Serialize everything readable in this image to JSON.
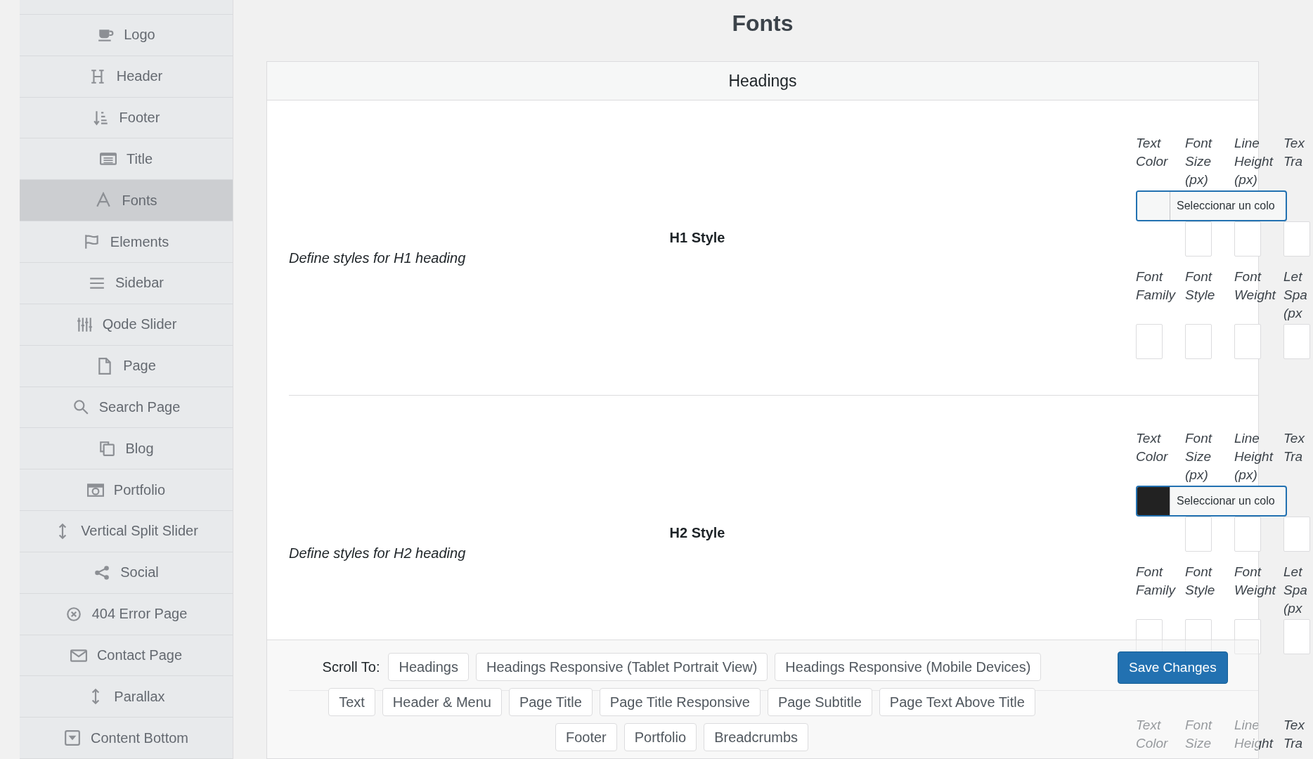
{
  "page_title": "Fonts",
  "sidebar": {
    "items": [
      {
        "label": "Logo",
        "selected": false
      },
      {
        "label": "Header",
        "selected": false
      },
      {
        "label": "Footer",
        "selected": false
      },
      {
        "label": "Title",
        "selected": false
      },
      {
        "label": "Fonts",
        "selected": true
      },
      {
        "label": "Elements",
        "selected": false
      },
      {
        "label": "Sidebar",
        "selected": false
      },
      {
        "label": "Qode Slider",
        "selected": false
      },
      {
        "label": "Page",
        "selected": false
      },
      {
        "label": "Search Page",
        "selected": false
      },
      {
        "label": "Blog",
        "selected": false
      },
      {
        "label": "Portfolio",
        "selected": false
      },
      {
        "label": "Vertical Split Slider",
        "selected": false
      },
      {
        "label": "Social",
        "selected": false
      },
      {
        "label": "404 Error Page",
        "selected": false
      },
      {
        "label": "Contact Page",
        "selected": false
      },
      {
        "label": "Parallax",
        "selected": false
      },
      {
        "label": "Content Bottom",
        "selected": false
      }
    ]
  },
  "panel": {
    "title": "Headings",
    "sections": [
      {
        "title": "H1 Style",
        "description": "Define styles for H1 heading",
        "field_rows": [
          {
            "fields": [
              {
                "kind": "color",
                "label": "Text Color",
                "color": "#f6f7f7",
                "button": "Seleccionar un colo"
              },
              {
                "kind": "input",
                "label": "Font Size (px)"
              },
              {
                "kind": "input",
                "label": "Line Height (px)"
              },
              {
                "kind": "input",
                "label": "Tex Tra"
              }
            ]
          },
          {
            "fields": [
              {
                "kind": "input",
                "label": "Font Family"
              },
              {
                "kind": "input",
                "label": "Font Style"
              },
              {
                "kind": "input",
                "label": "Font Weight"
              },
              {
                "kind": "input",
                "label": "Let Spa (px"
              }
            ]
          }
        ]
      },
      {
        "title": "H2 Style",
        "description": "Define styles for H2 heading",
        "field_rows": [
          {
            "fields": [
              {
                "kind": "color",
                "label": "Text Color",
                "color": "#222222",
                "button": "Seleccionar un colo"
              },
              {
                "kind": "input",
                "label": "Font Size (px)"
              },
              {
                "kind": "input",
                "label": "Line Height (px)"
              },
              {
                "kind": "input",
                "label": "Tex Tra"
              }
            ]
          },
          {
            "fields": [
              {
                "kind": "input",
                "label": "Font Family"
              },
              {
                "kind": "input",
                "label": "Font Style"
              },
              {
                "kind": "input",
                "label": "Font Weight"
              },
              {
                "kind": "input",
                "label": "Let Spa (px"
              }
            ]
          }
        ]
      },
      {
        "field_rows": [
          {
            "fields": [
              {
                "kind": "label",
                "label": "Text Color"
              },
              {
                "kind": "label",
                "label": "Font Size"
              },
              {
                "kind": "label",
                "label": "Line Height"
              },
              {
                "kind": "label",
                "label": "Tex Tra"
              }
            ]
          }
        ]
      }
    ]
  },
  "scroll_bar": {
    "label": "Scroll To:",
    "links": [
      "Headings",
      "Headings Responsive (Tablet Portrait View)",
      "Headings Responsive (Mobile Devices)",
      "Text",
      "Header & Menu",
      "Page Title",
      "Page Title Responsive",
      "Page Subtitle",
      "Page Text Above Title",
      "Footer",
      "Portfolio",
      "Breadcrumbs"
    ],
    "save_button": "Save Changes"
  }
}
